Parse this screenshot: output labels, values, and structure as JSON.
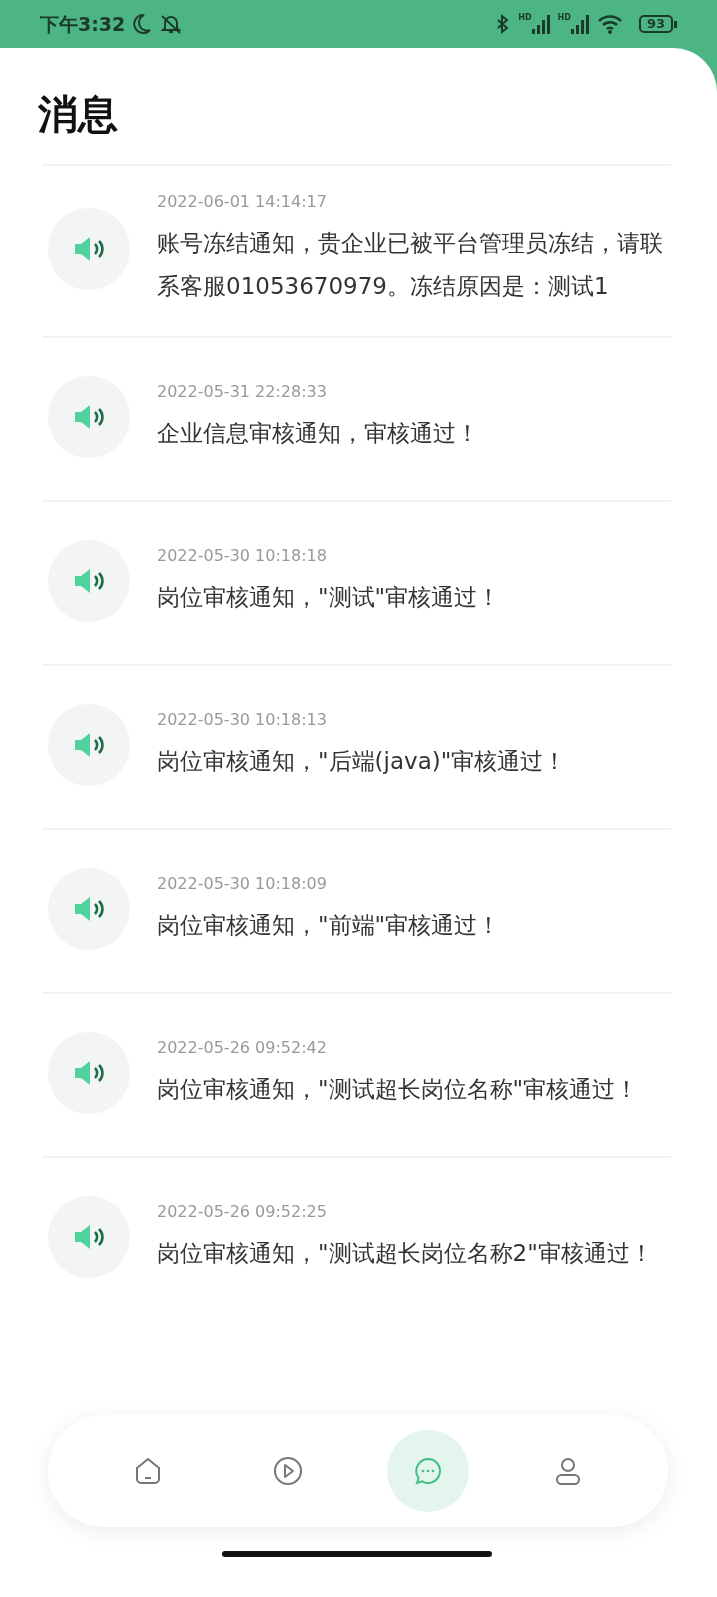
{
  "status_bar": {
    "time": "下午3:32",
    "signals": [
      {
        "label": "HD"
      },
      {
        "label": "HD"
      }
    ],
    "battery": "93"
  },
  "title": "消息",
  "messages": [
    {
      "time": "2022-06-01 14:14:17",
      "text": "账号冻结通知，贵企业已被平台管理员冻结，请联系客服01053670979。冻结原因是：测试1"
    },
    {
      "time": "2022-05-31 22:28:33",
      "text": "企业信息审核通知，审核通过！"
    },
    {
      "time": "2022-05-30 10:18:18",
      "text": "岗位审核通知，\"测试\"审核通过！"
    },
    {
      "time": "2022-05-30 10:18:13",
      "text": "岗位审核通知，\"后端(java)\"审核通过！"
    },
    {
      "time": "2022-05-30 10:18:09",
      "text": "岗位审核通知，\"前端\"审核通过！"
    },
    {
      "time": "2022-05-26 09:52:42",
      "text": "岗位审核通知，\"测试超长岗位名称\"审核通过！"
    },
    {
      "time": "2022-05-26 09:52:25",
      "text": "岗位审核通知，\"测试超长岗位名称2\"审核通过！"
    }
  ],
  "nav": [
    {
      "kind": "home",
      "selected": false
    },
    {
      "kind": "play",
      "selected": false
    },
    {
      "kind": "chat",
      "selected": true
    },
    {
      "kind": "profile",
      "selected": false
    }
  ]
}
